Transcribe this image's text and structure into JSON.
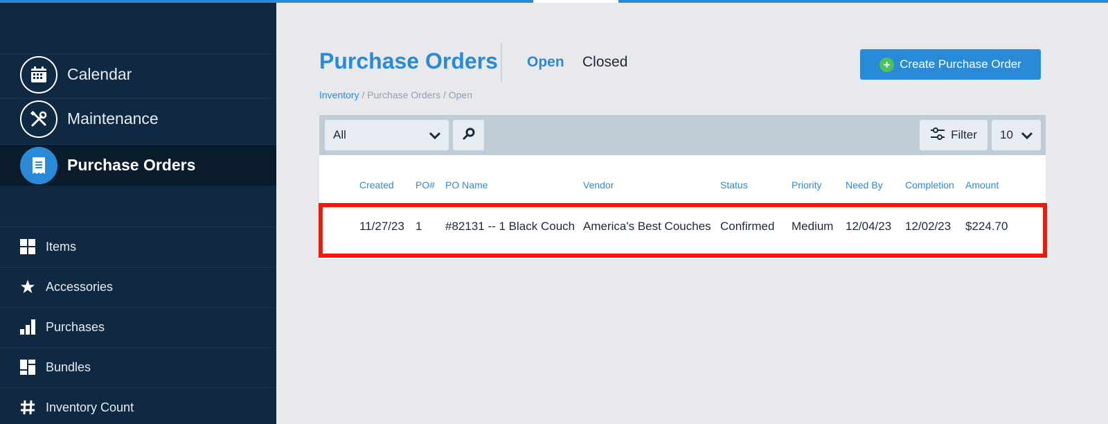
{
  "sidebar": {
    "main_items": [
      {
        "label": "Calendar",
        "icon": "calendar-icon"
      },
      {
        "label": "Maintenance",
        "icon": "tools-icon"
      },
      {
        "label": "Purchase Orders",
        "icon": "receipt-icon",
        "active": true
      }
    ],
    "sub_items": [
      {
        "label": "Items",
        "icon": "grid-icon"
      },
      {
        "label": "Accessories",
        "icon": "star-icon"
      },
      {
        "label": "Purchases",
        "icon": "bar-chart-icon"
      },
      {
        "label": "Bundles",
        "icon": "bundle-icon"
      },
      {
        "label": "Inventory Count",
        "icon": "hash-icon"
      }
    ]
  },
  "header": {
    "title": "Purchase Orders",
    "tabs": [
      {
        "label": "Open",
        "active": true
      },
      {
        "label": "Closed",
        "active": false
      }
    ],
    "create_button": "Create Purchase Order"
  },
  "breadcrumb": {
    "link": "Inventory",
    "rest": " / Purchase Orders / Open"
  },
  "toolbar": {
    "select_value": "All",
    "filter_label": "Filter",
    "per_page": "10"
  },
  "table": {
    "columns": [
      "Created",
      "PO#",
      "PO Name",
      "Vendor",
      "Status",
      "Priority",
      "Need By",
      "Completion",
      "Amount"
    ],
    "rows": [
      [
        "11/27/23",
        "1",
        "#82131 -- 1 Black Couch",
        "America's Best Couches",
        "Confirmed",
        "Medium",
        "12/04/23",
        "12/02/23",
        "$224.70"
      ]
    ]
  },
  "colors": {
    "accent": "#2a8ad8",
    "sidebar": "#0f2942",
    "highlight": "#f0190a",
    "create_plus": "#4cc25a"
  }
}
